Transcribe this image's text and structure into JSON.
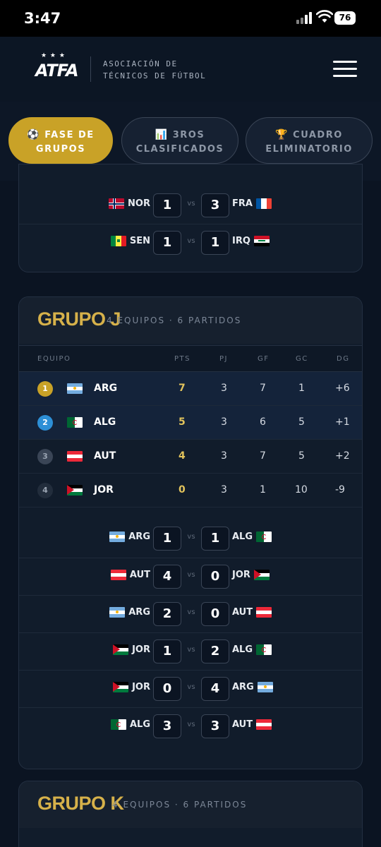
{
  "status_bar": {
    "time": "3:47",
    "battery": "76"
  },
  "header": {
    "logo_text": "ATFA",
    "org_line1": "ASOCIACIÓN DE",
    "org_line2": "TÉCNICOS DE FÚTBOL"
  },
  "tabs": [
    {
      "icon": "⚽",
      "line1": "FASE DE",
      "line2": "GRUPOS",
      "active": true
    },
    {
      "icon": "📊",
      "line1": "3ROS",
      "line2": "CLASIFICADOS",
      "active": false
    },
    {
      "icon": "🏆",
      "line1": "CUADRO",
      "line2": "ELIMINATORIO",
      "active": false
    }
  ],
  "prev_group_matches": [
    {
      "home": "NOR",
      "home_flag": "NOR",
      "home_score": "1",
      "away_score": "3",
      "away": "FRA",
      "away_flag": "FRA"
    },
    {
      "home": "SEN",
      "home_flag": "SEN",
      "home_score": "1",
      "away_score": "1",
      "away": "IRQ",
      "away_flag": "IRQ"
    }
  ],
  "vs_label": "vs",
  "group_j": {
    "title": "GRUPO J",
    "subtitle": "4 EQUIPOS · 6 PARTIDOS",
    "columns": {
      "team": "EQUIPO",
      "pts": "PTS",
      "pj": "PJ",
      "gf": "GF",
      "gc": "GC",
      "dg": "DG"
    },
    "rows": [
      {
        "pos": "1",
        "flag": "ARG",
        "team": "ARG",
        "pts": "7",
        "pj": "3",
        "gf": "7",
        "gc": "1",
        "dg": "+6",
        "pos_color": "#c9a227"
      },
      {
        "pos": "2",
        "flag": "ALG",
        "team": "ALG",
        "pts": "5",
        "pj": "3",
        "gf": "6",
        "gc": "5",
        "dg": "+1",
        "pos_color": "#2d8fd6"
      },
      {
        "pos": "3",
        "flag": "AUT",
        "team": "AUT",
        "pts": "4",
        "pj": "3",
        "gf": "7",
        "gc": "5",
        "dg": "+2",
        "pos_color": "#3a4556"
      },
      {
        "pos": "4",
        "flag": "JOR",
        "team": "JOR",
        "pts": "0",
        "pj": "3",
        "gf": "1",
        "gc": "10",
        "dg": "-9",
        "pos_color": "#222d3c"
      }
    ],
    "matches": [
      {
        "home": "ARG",
        "home_flag": "ARG",
        "home_score": "1",
        "away_score": "1",
        "away": "ALG",
        "away_flag": "ALG"
      },
      {
        "home": "AUT",
        "home_flag": "AUT",
        "home_score": "4",
        "away_score": "0",
        "away": "JOR",
        "away_flag": "JOR"
      },
      {
        "home": "ARG",
        "home_flag": "ARG",
        "home_score": "2",
        "away_score": "0",
        "away": "AUT",
        "away_flag": "AUT"
      },
      {
        "home": "JOR",
        "home_flag": "JOR",
        "home_score": "1",
        "away_score": "2",
        "away": "ALG",
        "away_flag": "ALG"
      },
      {
        "home": "JOR",
        "home_flag": "JOR",
        "home_score": "0",
        "away_score": "4",
        "away": "ARG",
        "away_flag": "ARG"
      },
      {
        "home": "ALG",
        "home_flag": "ALG",
        "home_score": "3",
        "away_score": "3",
        "away": "AUT",
        "away_flag": "AUT"
      }
    ]
  },
  "group_k": {
    "title": "GRUPO K",
    "subtitle": "4 EQUIPOS · 6 PARTIDOS"
  }
}
